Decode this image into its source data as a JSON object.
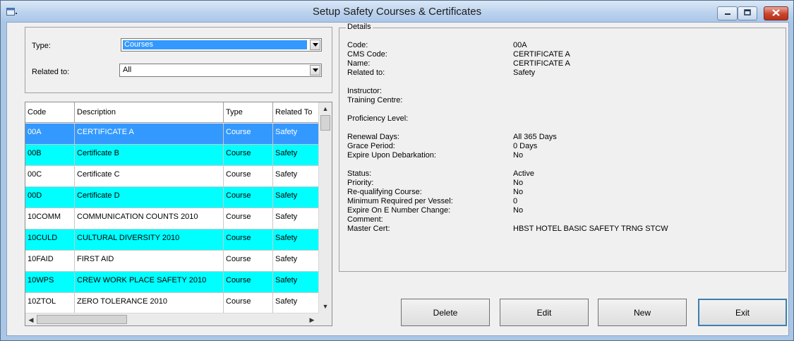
{
  "window": {
    "title": "Setup Safety Courses & Certificates"
  },
  "filters": {
    "type_label": "Type:",
    "type_value": "Courses",
    "related_label": "Related to:",
    "related_value": "All"
  },
  "grid": {
    "columns": [
      "Code",
      "Description",
      "Type",
      "Related To"
    ],
    "rows": [
      {
        "code": "00A",
        "description": "CERTIFICATE A",
        "type": "Course",
        "related": "Safety",
        "state": "selected"
      },
      {
        "code": "00B",
        "description": "Certificate B",
        "type": "Course",
        "related": "Safety",
        "state": "highlight"
      },
      {
        "code": "00C",
        "description": "Certificate C",
        "type": "Course",
        "related": "Safety",
        "state": "normal"
      },
      {
        "code": "00D",
        "description": "Certificate D",
        "type": "Course",
        "related": "Safety",
        "state": "highlight"
      },
      {
        "code": "10COMM",
        "description": "COMMUNICATION COUNTS 2010",
        "type": "Course",
        "related": "Safety",
        "state": "normal"
      },
      {
        "code": "10CULD",
        "description": "CULTURAL DIVERSITY 2010",
        "type": "Course",
        "related": "Safety",
        "state": "highlight"
      },
      {
        "code": "10FAID",
        "description": "FIRST AID",
        "type": "Course",
        "related": "Safety",
        "state": "normal"
      },
      {
        "code": "10WPS",
        "description": "CREW WORK PLACE SAFETY 2010",
        "type": "Course",
        "related": "Safety",
        "state": "highlight"
      },
      {
        "code": "10ZTOL",
        "description": "ZERO TOLERANCE 2010",
        "type": "Course",
        "related": "Safety",
        "state": "normal"
      }
    ]
  },
  "details": {
    "legend": "Details",
    "fields": [
      {
        "label": "Code:",
        "value": "00A"
      },
      {
        "label": "CMS Code:",
        "value": "CERTIFICATE A"
      },
      {
        "label": "Name:",
        "value": "CERTIFICATE A"
      },
      {
        "label": "Related to:",
        "value": "Safety"
      },
      {
        "label": "Instructor:",
        "value": ""
      },
      {
        "label": "Training Centre:",
        "value": ""
      },
      {
        "label": "Proficiency Level:",
        "value": ""
      },
      {
        "label": "Renewal Days:",
        "value": "All 365 Days"
      },
      {
        "label": "Grace Period:",
        "value": "0 Days"
      },
      {
        "label": "Expire Upon Debarkation:",
        "value": "No"
      },
      {
        "label": "Status:",
        "value": "Active"
      },
      {
        "label": "Priority:",
        "value": "No"
      },
      {
        "label": "Re-qualifying Course:",
        "value": "No"
      },
      {
        "label": "Minimum Required per Vessel:",
        "value": "0"
      },
      {
        "label": "Expire On E Number Change:",
        "value": "No"
      },
      {
        "label": "Comment:",
        "value": ""
      },
      {
        "label": "Master Cert:",
        "value": "HBST HOTEL BASIC SAFETY TRNG STCW"
      }
    ]
  },
  "buttons": {
    "delete": "Delete",
    "edit": "Edit",
    "new": "New",
    "exit": "Exit"
  },
  "colors": {
    "selected_row": "#3399ff",
    "highlight_row": "#00ffff",
    "normal_row": "#ffffff"
  },
  "icons": {
    "app": "app-icon",
    "minimize": "minimize-icon",
    "maximize": "maximize-icon",
    "close": "close-icon"
  }
}
